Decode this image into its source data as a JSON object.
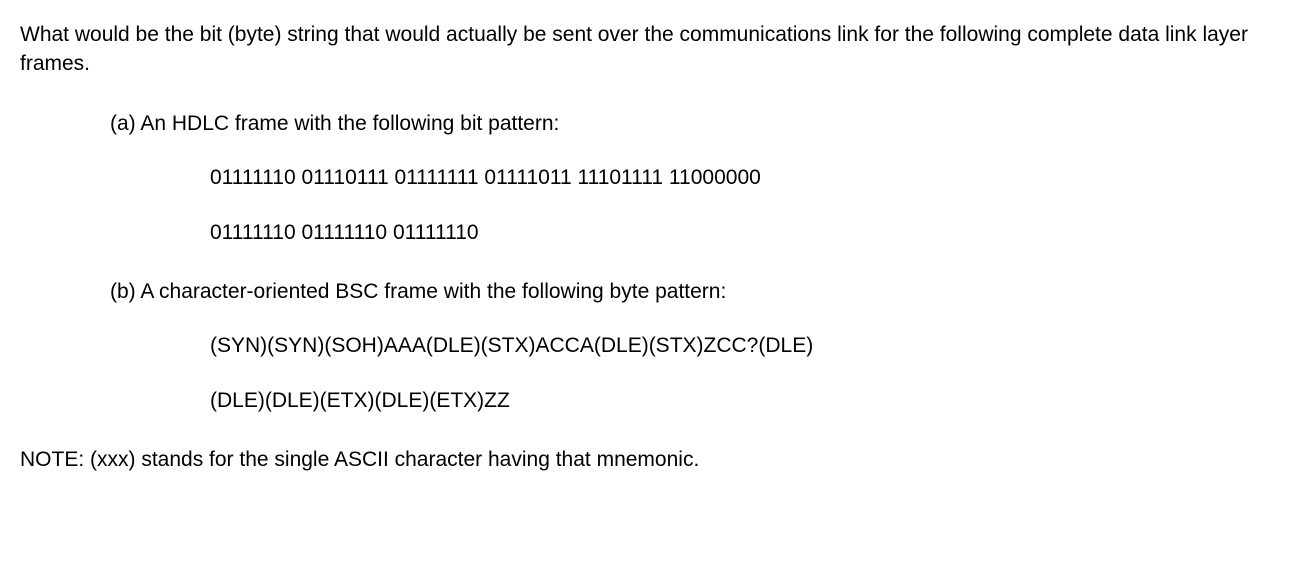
{
  "intro": "What would be the bit (byte) string that would actually be sent over the communications link for the following complete data link layer frames.",
  "partA": {
    "label": "(a) An HDLC frame with the following bit pattern:",
    "line1": "01111110 01110111 01111111 01111011 11101111 11000000",
    "line2": "01111110 01111110 01111110"
  },
  "partB": {
    "label": "(b) A character-oriented BSC frame with the following byte pattern:",
    "line1": "(SYN)(SYN)(SOH)AAA(DLE)(STX)ACCA(DLE)(STX)ZCC?(DLE)",
    "line2": "(DLE)(DLE)(ETX)(DLE)(ETX)ZZ"
  },
  "note": "NOTE: (xxx) stands for the single ASCII character having that mnemonic."
}
